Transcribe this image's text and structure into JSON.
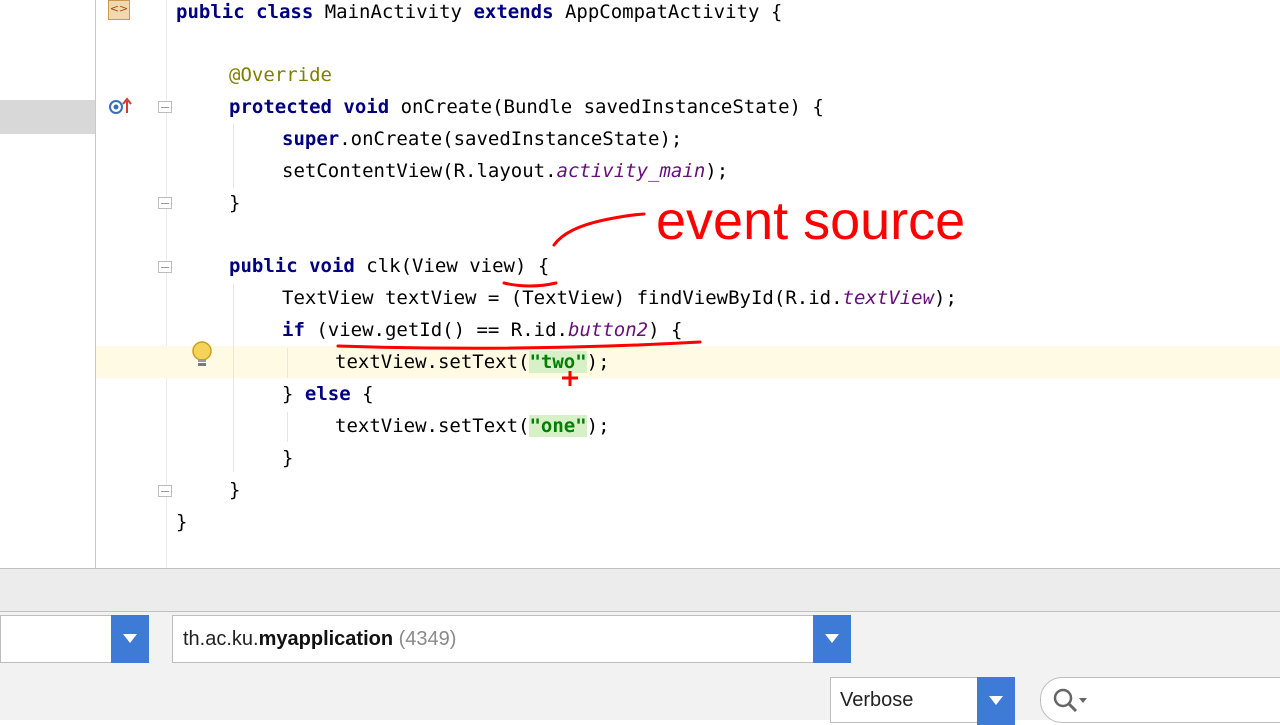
{
  "editor": {
    "lines": {
      "l1_kw": "public class ",
      "l1_rest": "MainActivity ",
      "l1_kw2": "extends ",
      "l1_end": "AppCompatActivity {",
      "l3_ann": "@Override",
      "l4_kw": "protected void ",
      "l4_rest": "onCreate(Bundle savedInstanceState) {",
      "l5_kw": "super",
      "l5_rest": ".onCreate(savedInstanceState);",
      "l6_a": "setContentView(R.layout.",
      "l6_field": "activity_main",
      "l6_b": ");",
      "l7": "}",
      "l9_kw": "public void ",
      "l9_rest": "clk(View view) {",
      "l10_a": "TextView textView = (TextView) findViewById(R.id.",
      "l10_field": "textView",
      "l10_b": ");",
      "l11_kw": "if ",
      "l11_a": "(view.getId() == R.id.",
      "l11_field": "button2",
      "l11_b": ") {",
      "l12_a": "textView.setText(",
      "l12_str": "\"two\"",
      "l12_b": ");",
      "l13_a": "} ",
      "l13_kw": "else",
      "l13_b": " {",
      "l14_a": "textView.setText(",
      "l14_str": "\"one\"",
      "l14_b": ");",
      "l15": "}",
      "l16": "}",
      "l17": "}"
    },
    "annotation": "event source"
  },
  "logcat": {
    "process": {
      "package": "th.ac.ku.",
      "app": "myapplication",
      "pid": " (4349)"
    },
    "log_level": "Verbose",
    "search_value": ""
  },
  "colors": {
    "keyword": "#000080",
    "annotation": "#808000",
    "string": "#008000",
    "field": "#660e7a",
    "ink": "#ff0000",
    "dropdown_button": "#3d7bd6"
  }
}
